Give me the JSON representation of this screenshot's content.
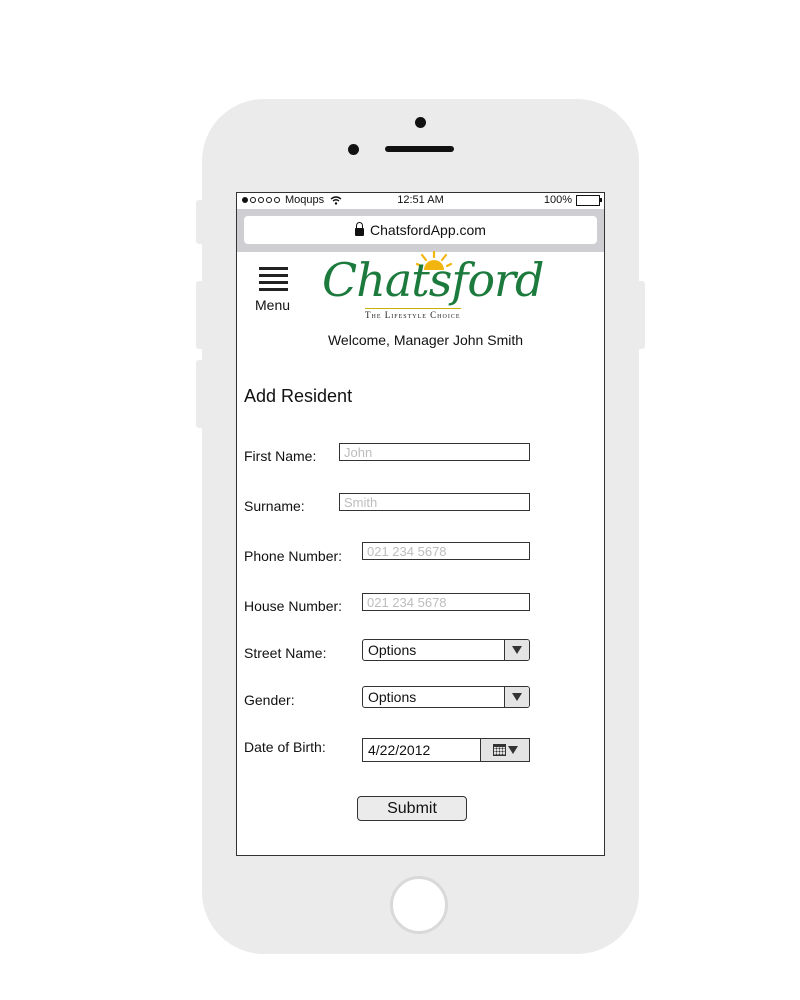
{
  "status_bar": {
    "carrier": "Moqups",
    "time": "12:51 AM",
    "battery": "100%"
  },
  "browser": {
    "url": "ChatsfordApp.com"
  },
  "header": {
    "menu_label": "Menu",
    "logo_text": "Chatsford",
    "logo_tagline": "The Lifestyle Choice",
    "welcome": "Welcome, Manager John Smith"
  },
  "form": {
    "title": "Add Resident",
    "first_name": {
      "label": "First Name:",
      "placeholder": "John",
      "value": ""
    },
    "surname": {
      "label": "Surname:",
      "placeholder": "Smith",
      "value": ""
    },
    "phone_number": {
      "label": "Phone Number:",
      "placeholder": "021 234 5678",
      "value": ""
    },
    "house_number": {
      "label": "House Number:",
      "placeholder": "021 234 5678",
      "value": ""
    },
    "street_name": {
      "label": "Street Name:",
      "selected": "Options"
    },
    "gender": {
      "label": "Gender:",
      "selected": "Options"
    },
    "date_of_birth": {
      "label": "Date of Birth:",
      "value": "4/22/2012"
    },
    "submit_label": "Submit"
  },
  "colors": {
    "logo_green": "#1b7a3c",
    "sun_yellow": "#f2b50f",
    "phone_body": "#ebebeb",
    "url_bar": "#cfcfd3"
  }
}
